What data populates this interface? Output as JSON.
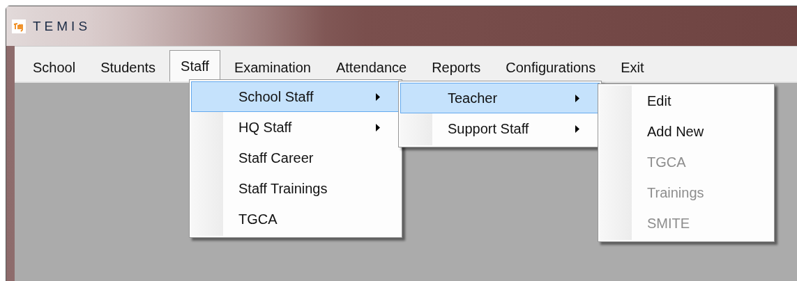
{
  "window": {
    "title": "TEMIS"
  },
  "menu_bar": [
    {
      "label": "School",
      "selected": false
    },
    {
      "label": "Students",
      "selected": false
    },
    {
      "label": "Staff",
      "selected": true
    },
    {
      "label": "Examination",
      "selected": false
    },
    {
      "label": "Attendance",
      "selected": false
    },
    {
      "label": "Reports",
      "selected": false
    },
    {
      "label": "Configurations",
      "selected": false
    },
    {
      "label": "Exit",
      "selected": false
    }
  ],
  "open_menus": [
    {
      "items": [
        {
          "label": "School Staff",
          "selected": true,
          "submenu": true,
          "disabled": false
        },
        {
          "label": "HQ Staff",
          "selected": false,
          "submenu": true,
          "disabled": false
        },
        {
          "label": "Staff Career",
          "selected": false,
          "submenu": false,
          "disabled": false
        },
        {
          "label": "Staff Trainings",
          "selected": false,
          "submenu": false,
          "disabled": false
        },
        {
          "label": "TGCA",
          "selected": false,
          "submenu": false,
          "disabled": false
        }
      ]
    },
    {
      "items": [
        {
          "label": "Teacher",
          "selected": true,
          "submenu": true,
          "disabled": false
        },
        {
          "label": "Support Staff",
          "selected": false,
          "submenu": true,
          "disabled": false
        }
      ]
    },
    {
      "items": [
        {
          "label": "Edit",
          "selected": false,
          "submenu": false,
          "disabled": false
        },
        {
          "label": "Add New",
          "selected": false,
          "submenu": false,
          "disabled": false
        },
        {
          "label": "TGCA",
          "selected": false,
          "submenu": false,
          "disabled": true
        },
        {
          "label": "Trainings",
          "selected": false,
          "submenu": false,
          "disabled": true
        },
        {
          "label": "SMITE",
          "selected": false,
          "submenu": false,
          "disabled": true
        }
      ]
    }
  ]
}
